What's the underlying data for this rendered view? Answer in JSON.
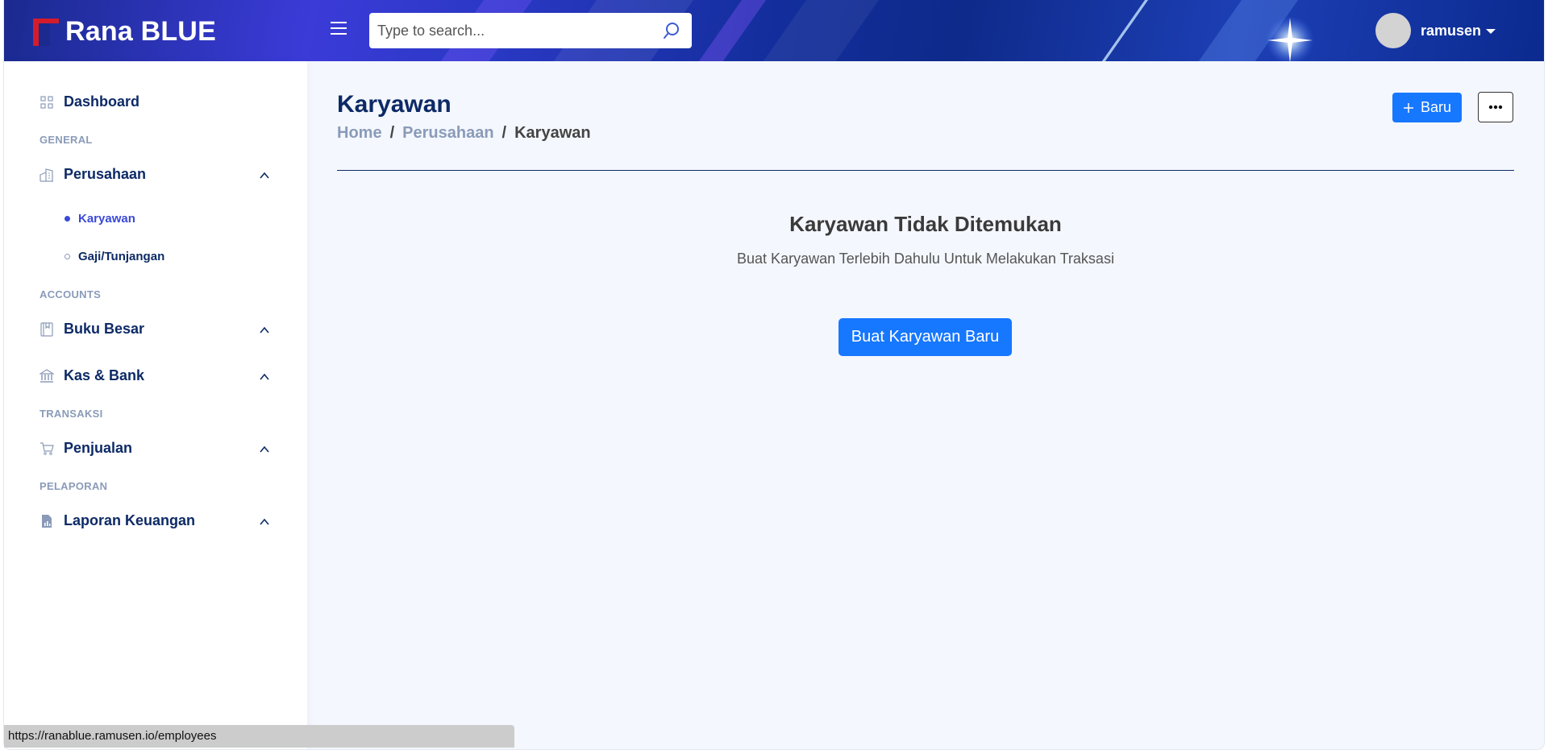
{
  "header": {
    "app_name": "Rana BLUE",
    "search_placeholder": "Type to search...",
    "username": "ramusen"
  },
  "sidebar": {
    "dashboard": "Dashboard",
    "sections": {
      "general": "GENERAL",
      "accounts": "ACCOUNTS",
      "transaksi": "TRANSAKSI",
      "pelaporan": "PELAPORAN"
    },
    "perusahaan": "Perusahaan",
    "perusahaan_sub": [
      "Karyawan",
      "Gaji/Tunjangan"
    ],
    "buku_besar": "Buku Besar",
    "kas_bank": "Kas & Bank",
    "penjualan": "Penjualan",
    "laporan": "Laporan Keuangan"
  },
  "main": {
    "title": "Karyawan",
    "breadcrumb": [
      "Home",
      "Perusahaan",
      "Karyawan"
    ],
    "separator": "/",
    "new_button": "Baru",
    "empty_title": "Karyawan Tidak Ditemukan",
    "empty_subtitle": "Buat Karyawan Terlebih Dahulu Untuk Melakukan Traksasi",
    "create_button": "Buat Karyawan Baru"
  },
  "status_url": "https://ranablue.ramusen.io/employees",
  "colors": {
    "primary": "#1677ff",
    "nav_text": "#0d2a66",
    "active_sub": "#3a49d9",
    "section_text": "#8a9bb8",
    "logo_red": "#d51c2b"
  }
}
